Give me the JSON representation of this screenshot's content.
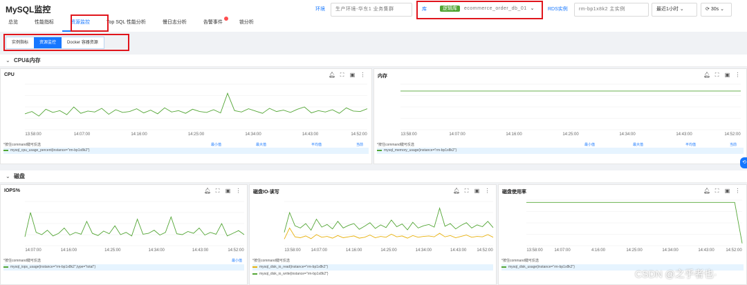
{
  "app": {
    "title": "MySQL监控"
  },
  "tabs": [
    {
      "label": "总览"
    },
    {
      "label": "性能指标"
    },
    {
      "label": "资源监控"
    },
    {
      "label": "Top SQL 性能分析"
    },
    {
      "label": "慢日志分析"
    },
    {
      "label": "告警事件"
    },
    {
      "label": "锁分析"
    }
  ],
  "filters": {
    "env_label": "环境",
    "env_value": "生产环境-华东1 业务集群",
    "db_label": "库",
    "db_tag": "逻辑库",
    "db_value": "ecommerce_order_db_01",
    "rds_label": "RDS实例",
    "rds_value": "rm-bp1x8k2 主实例",
    "time_range": "最近1小时",
    "refresh": "30s"
  },
  "subtabs": [
    {
      "label": "实例指标"
    },
    {
      "label": "资源监控"
    },
    {
      "label": "Docker 容器资源"
    }
  ],
  "sections": {
    "cpu_mem": "CPU&内存",
    "disk": "磁盘"
  },
  "legend_headers": {
    "min": "最小值",
    "max": "最大值",
    "avg": "平均值",
    "current": "当前"
  },
  "panels": {
    "cpu": {
      "title": "CPU",
      "legend_name": "*按住command键可反选",
      "row1": "mysql_cpu_usage_percent{instance=\"rm-bp1x8k2\"}"
    },
    "mem": {
      "title": "内存",
      "legend_name": "*按住command键可反选",
      "row1": "mysql_memory_usage{instance=\"rm-bp1x8k2\"}"
    },
    "iops": {
      "title": "IOPS%",
      "legend_name": "*按住command键可反选",
      "row1": "mysql_iops_usage{instance=\"rm-bp1x8k2\",type=\"total\"}"
    },
    "diskio": {
      "title": "磁盘IO-读写",
      "legend_name": "*按住command键可反选",
      "row1": "mysql_disk_io_read{instance=\"rm-bp1x8k2\"}",
      "row2": "mysql_disk_io_write{instance=\"rm-bp1x8k2\"}"
    },
    "diskuse": {
      "title": "磁盘使用率",
      "legend_name": "*按住command键可反选",
      "row1": "mysql_disk_usage{instance=\"rm-bp1x8k2\"}"
    }
  },
  "watermark": "CSDN @之乎者也·",
  "colors": {
    "primary": "#1677ff",
    "green": "#52a534",
    "yellow": "#e8b00a",
    "red": "#e0141b"
  },
  "chart_data": [
    {
      "type": "line",
      "title": "CPU",
      "x": [
        "13:58:00",
        "14:07:00",
        "14:16:00",
        "14:25:00",
        "14:34:00",
        "14:43:00",
        "14:52:00"
      ],
      "series": [
        {
          "values": [
            35,
            40,
            30,
            45,
            38,
            42,
            33,
            50,
            36,
            41,
            39,
            47,
            34,
            44,
            38,
            40,
            46,
            37,
            43,
            35,
            48,
            39,
            42,
            36,
            45,
            40,
            38,
            44,
            37,
            80,
            42,
            39,
            46,
            41,
            36,
            47,
            40,
            43,
            38,
            45,
            50,
            37,
            42,
            39,
            44,
            36,
            48,
            41,
            40,
            46
          ]
        }
      ],
      "ylim": [
        0,
        100
      ]
    },
    {
      "type": "line",
      "title": "内存",
      "x": [
        "13:58:00",
        "14:07:00",
        "14:16:00",
        "14:25:00",
        "14:34:00",
        "14:43:00",
        "14:52:00"
      ],
      "series": [
        {
          "values": [
            85,
            85,
            85,
            85,
            85,
            85,
            85,
            85,
            85,
            85,
            85,
            85,
            85,
            85,
            85,
            85,
            85,
            85,
            85,
            85
          ]
        }
      ],
      "ylim": [
        0,
        100
      ]
    },
    {
      "type": "line",
      "title": "IOPS%",
      "x": [
        "14:07:00",
        "14:16:00",
        "14:25:00",
        "14:34:00",
        "14:43:00",
        "14:52:00"
      ],
      "series": [
        {
          "values": [
            20,
            75,
            30,
            25,
            35,
            22,
            28,
            40,
            24,
            30,
            26,
            55,
            28,
            23,
            33,
            27,
            45,
            25,
            30,
            22,
            60,
            26,
            28,
            35,
            24,
            30,
            65,
            27,
            25,
            32,
            28,
            40,
            24,
            30,
            26,
            50,
            22,
            28,
            34,
            25
          ]
        }
      ],
      "ylim": [
        0,
        100
      ]
    },
    {
      "type": "line",
      "title": "磁盘IO-读写",
      "x": [
        "13:58:00",
        "14:07:00",
        "14:16:00",
        "14:25:00",
        "14:34:00",
        "14:43:00",
        "14:52:00"
      ],
      "series": [
        {
          "values": [
            30,
            75,
            45,
            40,
            50,
            35,
            60,
            42,
            48,
            38,
            55,
            40,
            46,
            50,
            37,
            44,
            52,
            39,
            47,
            41,
            58,
            43,
            49,
            36,
            53,
            40,
            45,
            48,
            42,
            85,
            44,
            50,
            38,
            46,
            52,
            40,
            47,
            43,
            55,
            41
          ]
        },
        {
          "values": [
            15,
            40,
            20,
            18,
            22,
            16,
            25,
            19,
            21,
            17,
            23,
            18,
            20,
            22,
            17,
            19,
            24,
            18,
            21,
            19,
            26,
            20,
            22,
            17,
            23,
            19,
            21,
            22,
            20,
            28,
            20,
            23,
            18,
            21,
            24,
            19,
            21,
            20,
            25,
            19
          ]
        }
      ],
      "ylim": [
        0,
        100
      ]
    },
    {
      "type": "line",
      "title": "磁盘使用率",
      "x": [
        "13:58:00",
        "14:07:00",
        "4:16:00",
        "14:25:00",
        "14:34:00",
        "14:43:00",
        "14:52:00"
      ],
      "series": [
        {
          "values": [
            95,
            95,
            95,
            95,
            95,
            95,
            95,
            95,
            95,
            95,
            95,
            95,
            95,
            95,
            95,
            95,
            95,
            95,
            95,
            95,
            95,
            95,
            95,
            95,
            95,
            95,
            95,
            95,
            95,
            5
          ]
        }
      ],
      "ylim": [
        0,
        100
      ]
    }
  ]
}
